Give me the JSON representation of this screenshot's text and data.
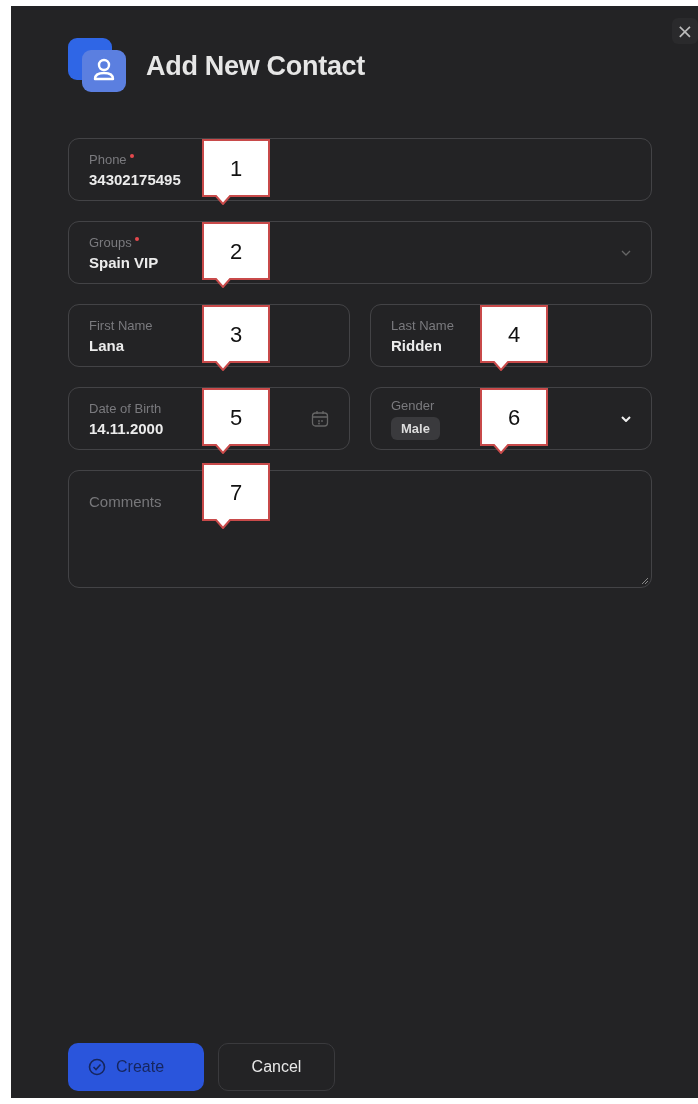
{
  "dialog": {
    "title": "Add New Contact",
    "close": "×"
  },
  "rows": [
    [
      {
        "kind": "text",
        "label": "Phone",
        "required": true,
        "value": "34302175495",
        "callout": "1"
      }
    ],
    [
      {
        "kind": "select",
        "label": "Groups",
        "required": true,
        "value": "Spain VIP",
        "callout": "2"
      }
    ],
    [
      {
        "kind": "text",
        "label": "First Name",
        "required": false,
        "value": "Lana",
        "callout": "3"
      },
      {
        "kind": "text",
        "label": "Last Name",
        "required": false,
        "value": "Ridden",
        "callout": "4"
      }
    ],
    [
      {
        "kind": "date",
        "label": "Date of Birth",
        "required": false,
        "value": "14.11.2000",
        "callout": "5"
      },
      {
        "kind": "chips",
        "label": "Gender",
        "required": false,
        "chips": [
          "Male"
        ],
        "callout": "6"
      }
    ],
    [
      {
        "kind": "textarea",
        "placeholder": "Comments",
        "callout": "7"
      }
    ]
  ],
  "buttons": [
    {
      "kind": "primary",
      "label": "Create"
    },
    {
      "kind": "secondary",
      "label": "Cancel"
    }
  ]
}
